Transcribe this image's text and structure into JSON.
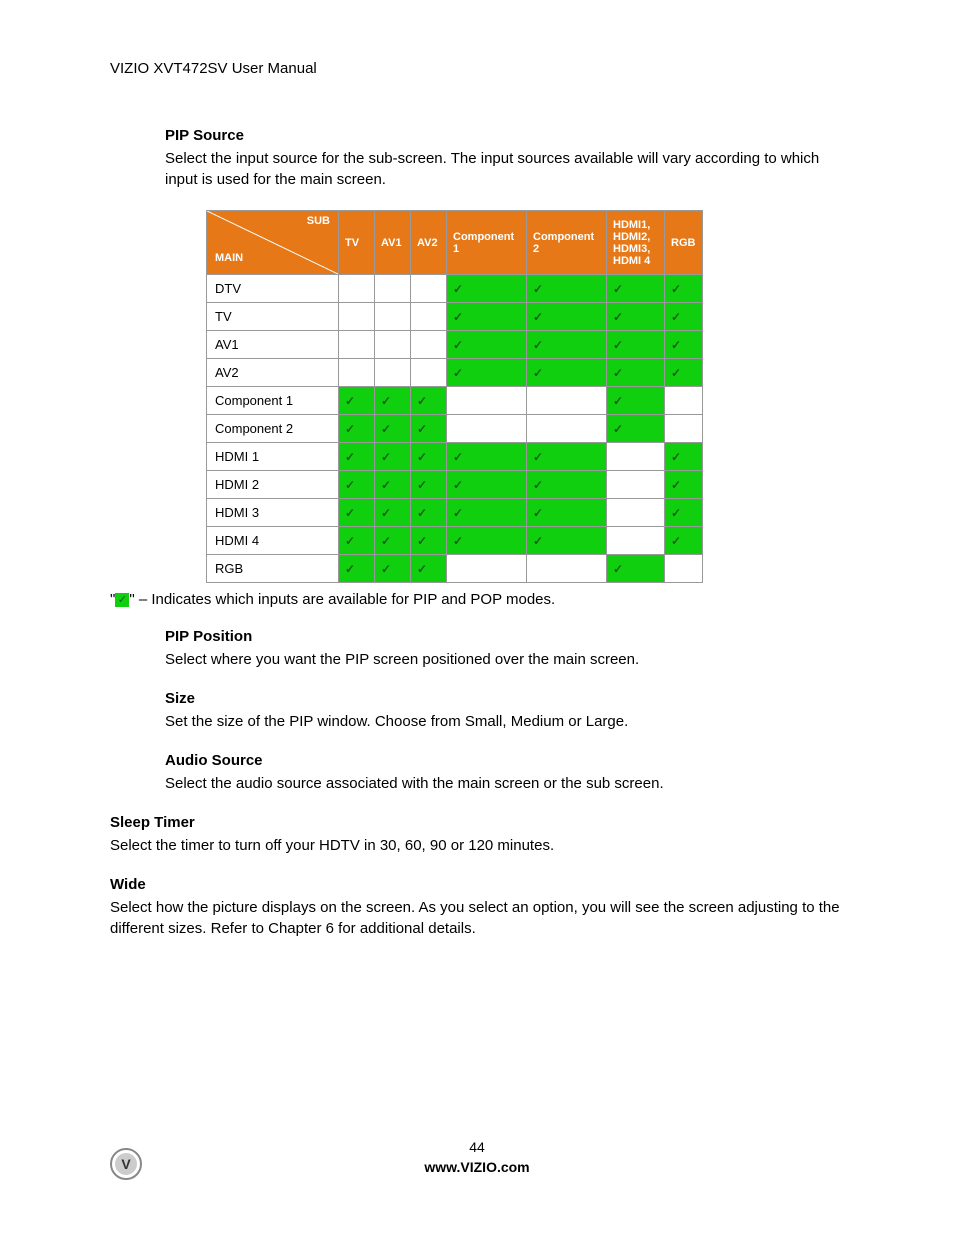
{
  "header": "VIZIO XVT472SV User Manual",
  "sections": {
    "pip_source": {
      "title": "PIP Source",
      "body": "Select the input source for the sub-screen. The input sources available will vary according to which input is used for the main screen."
    },
    "legend": "\" – Indicates which inputs are available for PIP and POP modes.",
    "pip_position": {
      "title": "PIP Position",
      "body": "Select where you want the PIP screen positioned over the main screen."
    },
    "size": {
      "title": "Size",
      "body": "Set the size of the PIP window. Choose from Small, Medium or Large."
    },
    "audio_source": {
      "title": "Audio Source",
      "body": "Select the audio source associated with the main screen or the sub screen."
    },
    "sleep_timer": {
      "title": "Sleep Timer",
      "body": "Select the timer to turn off your HDTV in 30, 60, 90 or 120 minutes."
    },
    "wide": {
      "title": "Wide",
      "body": "Select how the picture displays on the screen. As you select an option, you will see the screen adjusting to the different sizes. Refer to Chapter 6 for additional details."
    }
  },
  "table": {
    "corner": {
      "sub": "SUB",
      "main": "MAIN"
    },
    "cols": [
      "TV",
      "AV1",
      "AV2",
      "Component 1",
      "Component 2",
      "HDMI1, HDMI2, HDMI3, HDMI 4",
      "RGB"
    ],
    "rows": [
      {
        "label": "DTV",
        "cells": [
          0,
          0,
          0,
          1,
          1,
          1,
          1
        ]
      },
      {
        "label": "TV",
        "cells": [
          0,
          0,
          0,
          1,
          1,
          1,
          1
        ]
      },
      {
        "label": "AV1",
        "cells": [
          0,
          0,
          0,
          1,
          1,
          1,
          1
        ]
      },
      {
        "label": "AV2",
        "cells": [
          0,
          0,
          0,
          1,
          1,
          1,
          1
        ]
      },
      {
        "label": "Component 1",
        "cells": [
          1,
          1,
          1,
          0,
          0,
          1,
          0
        ]
      },
      {
        "label": "Component 2",
        "cells": [
          1,
          1,
          1,
          0,
          0,
          1,
          0
        ]
      },
      {
        "label": "HDMI 1",
        "cells": [
          1,
          1,
          1,
          1,
          1,
          0,
          1
        ]
      },
      {
        "label": "HDMI 2",
        "cells": [
          1,
          1,
          1,
          1,
          1,
          0,
          1
        ]
      },
      {
        "label": "HDMI 3",
        "cells": [
          1,
          1,
          1,
          1,
          1,
          0,
          1
        ]
      },
      {
        "label": "HDMI 4",
        "cells": [
          1,
          1,
          1,
          1,
          1,
          0,
          1
        ]
      },
      {
        "label": "RGB",
        "cells": [
          1,
          1,
          1,
          0,
          0,
          1,
          0
        ]
      }
    ]
  },
  "footer": {
    "page": "44",
    "url": "www.VIZIO.com"
  },
  "checkmark": "✓"
}
